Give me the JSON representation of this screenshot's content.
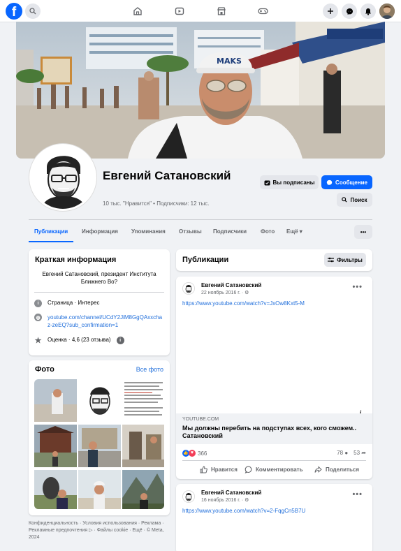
{
  "icons": {
    "logo": "facebook-logo",
    "search": "search-icon",
    "home": "home-icon",
    "video": "video-icon",
    "marketplace": "marketplace-icon",
    "gaming": "gaming-icon",
    "create": "plus-icon",
    "messenger": "messenger-icon",
    "notifications": "bell-icon",
    "account": "account-avatar"
  },
  "logo_letter": "f",
  "profile": {
    "name": "Евгений Сатановский",
    "stats": "10 тыс. \"Нравится\" • Подписчики: 12 тыс.",
    "subscribed_label": "Вы подписаны",
    "message_label": "Сообщение",
    "search_label": "Поиск",
    "more_label": "•••"
  },
  "tabs": [
    "Публикации",
    "Информация",
    "Упоминания",
    "Отзывы",
    "Подписчики",
    "Фото",
    "Ещё ▾"
  ],
  "intro": {
    "title": "Краткая информация",
    "bio": "Евгений Сатановский, президент Института Ближнего Во?",
    "page_type": "Страница · Интерес",
    "youtube_link": "youtube.com/channel/UCdY2JiM8GgQAxxchaz-zeEQ?sub_confirmation=1",
    "rating": "Оценка · 4,6 (23 отзыва)"
  },
  "photos": {
    "title": "Фото",
    "see_all": "Все фото"
  },
  "footer": "Конфиденциальность · Условия использования · Реклама · Рекламные предпочтения ▷ · Файлы cookie · Ещё · © Meta, 2024",
  "feed": {
    "title": "Публикации",
    "filters_label": "Фильтры"
  },
  "posts": [
    {
      "author": "Евгений Сатановский",
      "date": "22 ноябрь 2016 г. · ⚙",
      "url": "https://www.youtube.com/watch?v=JxOw8Kxt5-M",
      "link_domain": "YOUTUBE.COM",
      "link_title": "Мы должны перебить на подступах всех, кого сможем.. Сатановский",
      "reactions": "366",
      "comments": "78",
      "shares": "53",
      "like_label": "Нравится",
      "comment_label": "Комментировать",
      "share_label": "Поделиться"
    },
    {
      "author": "Евгений Сатановский",
      "date": "16 ноябрь 2016 г. · ⚙",
      "url": "https://www.youtube.com/watch?v=2-FqgCn5B7U"
    }
  ],
  "colors": {
    "brand": "#0866ff",
    "link": "#216fdb",
    "bg": "#f0f2f5"
  }
}
